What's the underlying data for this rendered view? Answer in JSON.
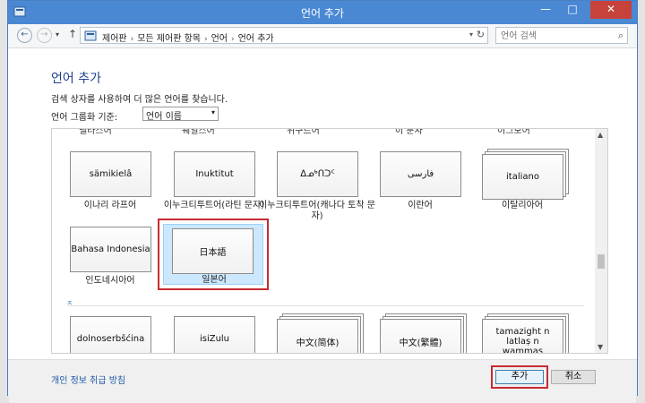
{
  "window": {
    "title": "언어 추가",
    "controls": {
      "minimize": "—",
      "maximize": "□",
      "close": "✕"
    }
  },
  "nav": {
    "back": "←",
    "forward": "→",
    "history": "▾",
    "up": "↑",
    "breadcrumbs": [
      "제어판",
      "모든 제어판 항목",
      "언어",
      "언어 추가"
    ],
    "dropdown": "▾",
    "refresh": "↻",
    "search_placeholder": "언어 검색",
    "search_icon": "⌕"
  },
  "page": {
    "heading": "언어 추가",
    "description": "검색 상자를 사용하여 더 많은 언어를 찾습니다.",
    "group_label": "언어 그룹화 기준:",
    "group_value": "언어 이름",
    "group_arrow": "▾"
  },
  "cutoff_labels": [
    "벨라스어",
    "웨일스어",
    "위구르어",
    "이 분자",
    "이그보어"
  ],
  "languages": [
    {
      "native": "sämikielâ",
      "label": "이나리 라프어"
    },
    {
      "native": "Inuktitut",
      "label": "이누크티투트어(라틴 문자)"
    },
    {
      "native": "ᐃᓄᒃᑎᑐᑦ",
      "label": "이누크티투트어(캐나다 토착 문자)"
    },
    {
      "native": "فارسی",
      "label": "이란어"
    },
    {
      "native": "italiano",
      "label": "이탈리아어"
    },
    {
      "native": "Bahasa Indonesia",
      "label": "인도네시아어"
    },
    {
      "native": "日本語",
      "label": "일본어"
    }
  ],
  "section_mark": "ㅈ",
  "next_languages": [
    {
      "native": "dolnoserbšćina"
    },
    {
      "native": "isiZulu"
    },
    {
      "native": "中文(简体)"
    },
    {
      "native": "中文(繁體)"
    },
    {
      "native": "tamazight n latlaṣ n wammas"
    }
  ],
  "scroll": {
    "up": "▲",
    "down": "▼"
  },
  "footer": {
    "privacy_link": "개인 정보 취급 방침",
    "add_button": "추가",
    "cancel_button": "취소"
  },
  "colors": {
    "titlebar": "#4a88d4",
    "heading": "#1e3f8c",
    "selection": "#cce8ff",
    "highlight_frame": "#c82b32"
  }
}
